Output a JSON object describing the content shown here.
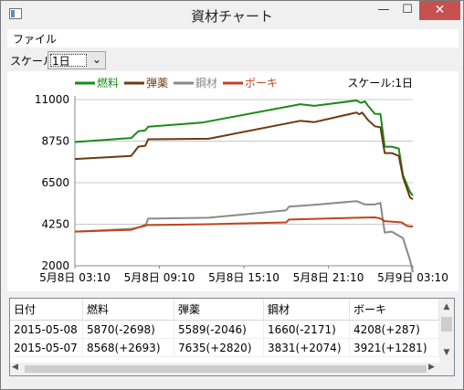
{
  "window": {
    "title": "資材チャート",
    "minimize_glyph": "—",
    "maximize_glyph": "☐",
    "close_glyph": "✕"
  },
  "menu": {
    "file_label": "ファイル"
  },
  "toolbar": {
    "scale_label": "スケール",
    "scale_value": "1日",
    "dropdown_icon": "chevron-down-icon"
  },
  "colors": {
    "fuel": "#1a8a1a",
    "ammo": "#6b3a10",
    "steel": "#8a8a8a",
    "bauxite": "#c0441c",
    "grid": "#c8c8c8",
    "close_button": "#c75050"
  },
  "chart_data": {
    "type": "line",
    "annotation": "スケール:1日",
    "legend_position": "top-left",
    "grid": "horizontal",
    "x_ticks": [
      "5月8日 03:10",
      "5月8日 09:10",
      "5月8日 15:10",
      "5月8日 21:10",
      "5月9日 03:10"
    ],
    "y_ticks": [
      "11000",
      "8750",
      "6500",
      "4250",
      "2000"
    ],
    "ylim": [
      2000,
      11000
    ],
    "xlim_hours": [
      0,
      24
    ],
    "series": [
      {
        "name": "燃料",
        "color": "#1a8a1a",
        "points": [
          [
            0,
            8700
          ],
          [
            4,
            8920
          ],
          [
            4.5,
            9280
          ],
          [
            5,
            9330
          ],
          [
            5.2,
            9530
          ],
          [
            9,
            9750
          ],
          [
            16,
            10750
          ],
          [
            17,
            10660
          ],
          [
            20,
            10950
          ],
          [
            20.3,
            10820
          ],
          [
            20.6,
            10900
          ],
          [
            20.8,
            10680
          ],
          [
            21.3,
            10230
          ],
          [
            21.7,
            10220
          ],
          [
            22,
            8450
          ],
          [
            22.5,
            8450
          ],
          [
            23,
            8350
          ],
          [
            23.3,
            6900
          ],
          [
            23.8,
            6000
          ],
          [
            24,
            5800
          ]
        ]
      },
      {
        "name": "弾薬",
        "color": "#6b3a10",
        "points": [
          [
            0,
            7780
          ],
          [
            4,
            7950
          ],
          [
            4.5,
            8450
          ],
          [
            5,
            8500
          ],
          [
            5.2,
            8850
          ],
          [
            9.5,
            8880
          ],
          [
            16,
            9850
          ],
          [
            17,
            9780
          ],
          [
            20,
            10300
          ],
          [
            20.2,
            10200
          ],
          [
            20.4,
            10300
          ],
          [
            20.8,
            9900
          ],
          [
            21.3,
            9550
          ],
          [
            21.7,
            9500
          ],
          [
            22,
            8100
          ],
          [
            22.5,
            8100
          ],
          [
            23,
            7950
          ],
          [
            23.3,
            6800
          ],
          [
            23.8,
            5700
          ],
          [
            24,
            5600
          ]
        ]
      },
      {
        "name": "鋼材",
        "color": "#8a8a8a",
        "points": [
          [
            0,
            3850
          ],
          [
            4,
            4000
          ],
          [
            5,
            4150
          ],
          [
            5.2,
            4550
          ],
          [
            9.5,
            4600
          ],
          [
            15,
            5000
          ],
          [
            15.2,
            5200
          ],
          [
            17,
            5300
          ],
          [
            20,
            5500
          ],
          [
            20.6,
            5320
          ],
          [
            21.3,
            5320
          ],
          [
            21.7,
            5400
          ],
          [
            22,
            3800
          ],
          [
            22.5,
            3850
          ],
          [
            23.3,
            3500
          ],
          [
            23.8,
            2300
          ],
          [
            24,
            1650
          ]
        ]
      },
      {
        "name": "ボーキ",
        "color": "#c0441c",
        "points": [
          [
            0,
            3850
          ],
          [
            4,
            3950
          ],
          [
            5,
            4200
          ],
          [
            9.5,
            4250
          ],
          [
            15,
            4350
          ],
          [
            15.2,
            4500
          ],
          [
            20,
            4600
          ],
          [
            21.3,
            4620
          ],
          [
            21.7,
            4560
          ],
          [
            22,
            4420
          ],
          [
            23.2,
            4350
          ],
          [
            23.6,
            4150
          ],
          [
            24,
            4120
          ]
        ]
      }
    ]
  },
  "table": {
    "columns": [
      "日付",
      "燃料",
      "弾薬",
      "鋼材",
      "ボーキ"
    ],
    "rows": [
      [
        "2015-05-08",
        "5870(-2698)",
        "5589(-2046)",
        "1660(-2171)",
        "4208(+287)"
      ],
      [
        "2015-05-07",
        "8568(+2693)",
        "7635(+2820)",
        "3831(+2074)",
        "3921(+1281)"
      ]
    ],
    "scroll_up_icon": "triangle-up-icon",
    "scroll_down_icon": "triangle-down-icon",
    "scroll_left_icon": "triangle-left-icon",
    "scroll_right_icon": "triangle-right-icon"
  }
}
